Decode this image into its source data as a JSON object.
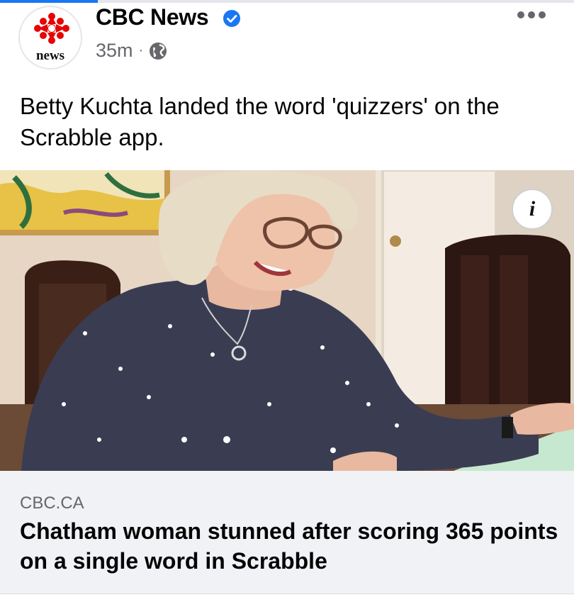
{
  "post": {
    "page_name": "CBC News",
    "avatar_text": "news",
    "timestamp": "35m",
    "separator": "·",
    "audience_icon": "globe-icon",
    "verified_icon": "verified-badge-icon",
    "caption": "Betty Kuchta landed the word 'quizzers' on the Scrabble app."
  },
  "link": {
    "domain": "CBC.CA",
    "headline": "Chatham woman stunned after scoring 365 points on a single word in Scrabble"
  },
  "photo": {
    "info_label": "i"
  },
  "colors": {
    "accent": "#1877f2",
    "cbc_red": "#e60505",
    "muted_text": "#65676b",
    "card_bg": "#f0f2f5"
  }
}
